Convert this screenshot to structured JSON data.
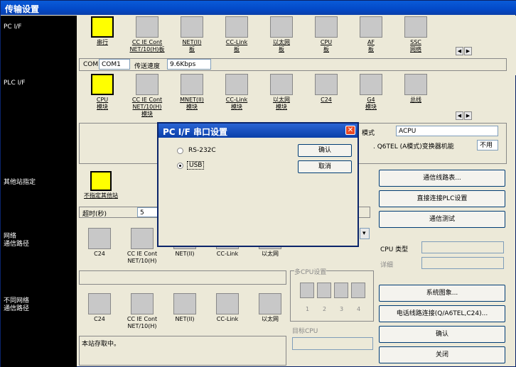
{
  "window": {
    "title": "传输设置"
  },
  "pc_if": {
    "label": "PC I/F",
    "items": [
      {
        "label": "串行",
        "selected": true
      },
      {
        "label": "CC IE Cont\nNET/10(H)板"
      },
      {
        "label": "NET(II)\n板"
      },
      {
        "label": "CC-Link\n板"
      },
      {
        "label": "以太网\n板"
      },
      {
        "label": "CPU\n板"
      },
      {
        "label": "AF\n板"
      },
      {
        "label": "SSC\n网络"
      }
    ],
    "com_label": "COM",
    "com_value": "COM1",
    "speed_label": "传送速度",
    "speed_value": "9.6Kbps"
  },
  "plc_if": {
    "label": "PLC I/F",
    "items": [
      {
        "label": "CPU\n模块",
        "selected": true
      },
      {
        "label": "CC IE Cont\nNET/10(H)\n模块"
      },
      {
        "label": "MNET(II)\n模块"
      },
      {
        "label": "CC-Link\n模块"
      },
      {
        "label": "以太网\n模块"
      },
      {
        "label": "C24"
      },
      {
        "label": "G4\n模块"
      },
      {
        "label": "总线"
      }
    ],
    "mode_label": "模式",
    "mode_value": "ACPU",
    "converter_label": ". Q6TEL (A模式)变换器机能",
    "converter_value": "不用"
  },
  "other_station": {
    "label": "其他站指定",
    "item_label": "不指定其他站",
    "timeout_label": "超时(秒)",
    "timeout_value": "5"
  },
  "network": {
    "label": "网络\n通信路径",
    "items": [
      {
        "label": "C24"
      },
      {
        "label": "CC IE Cont\nNET/10(H)"
      },
      {
        "label": "NET(II)"
      },
      {
        "label": "CC-Link"
      },
      {
        "label": "以太网"
      }
    ]
  },
  "diff_network": {
    "label": "不同网络\n通信路径",
    "items": [
      {
        "label": "C24"
      },
      {
        "label": "CC IE Cont\nNET/10(H)"
      },
      {
        "label": "NET(II)"
      },
      {
        "label": "CC-Link"
      },
      {
        "label": "以太网"
      }
    ],
    "status": "本站存取中。"
  },
  "multi_cpu": {
    "label": "多CPU设置",
    "cpus": [
      "1",
      "2",
      "3",
      "4"
    ],
    "target_label": "目标CPU"
  },
  "right_buttons": {
    "route_list": "通信线路表...",
    "direct_plc": "直接连接PLC设置",
    "comm_test": "通信测试",
    "cpu_type_label": "CPU 类型",
    "detail_label": "详细",
    "system_image": "系统图象...",
    "phone_line": "电话线路连接(Q/A6TEL,C24)...",
    "ok": "确认",
    "close": "关闭"
  },
  "dialog": {
    "title": "PC  I/F  串口设置",
    "options": [
      "RS-232C",
      "USB"
    ],
    "selected": "USB",
    "ok": "确认",
    "cancel": "取消"
  }
}
